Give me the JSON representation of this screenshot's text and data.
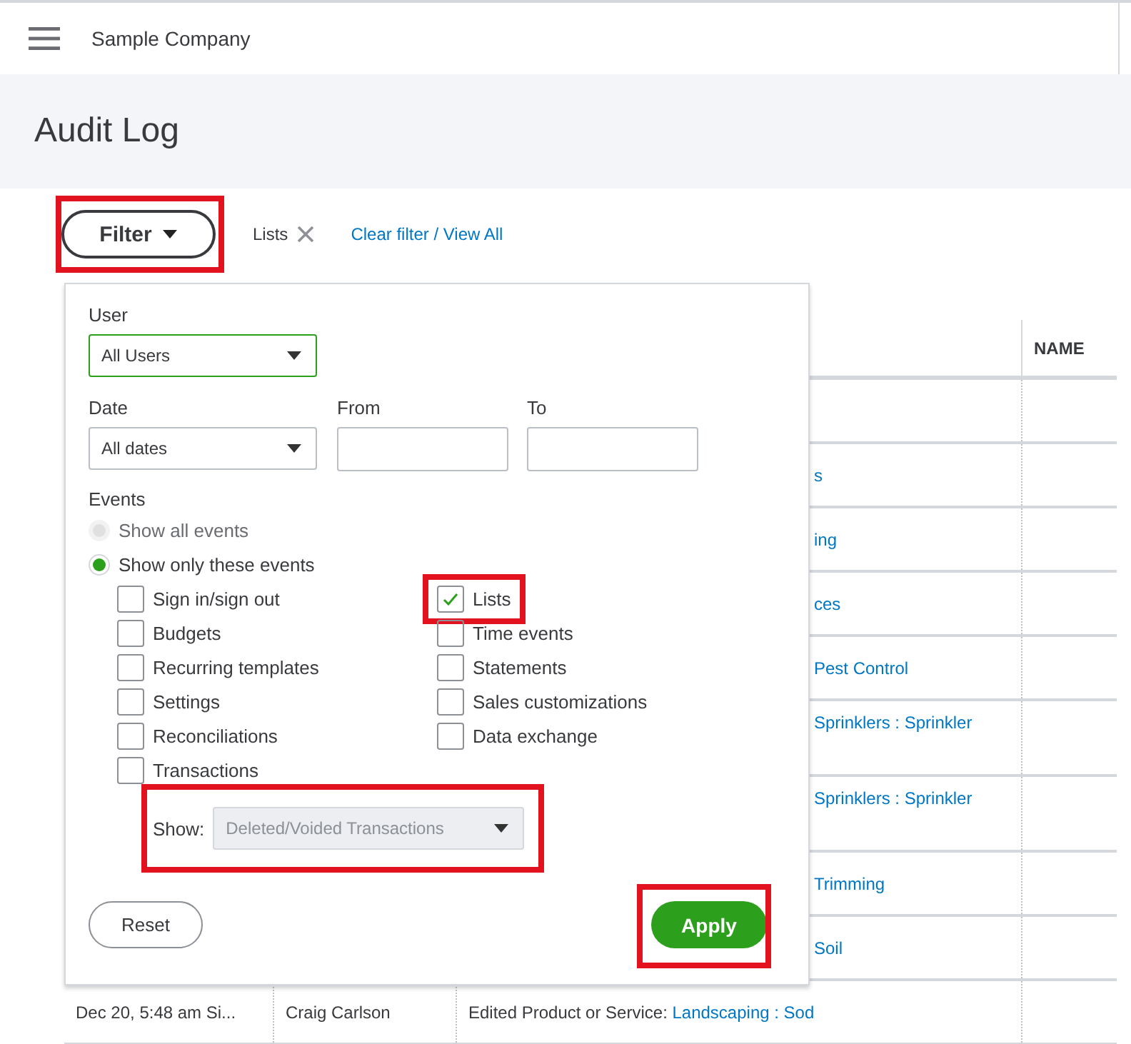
{
  "top_bar": {
    "company": "Sample Company"
  },
  "page_title": "Audit Log",
  "filter_bar": {
    "filter_button": {
      "label": "Filter",
      "highlighted": true
    },
    "chip": {
      "label": "Lists"
    },
    "clear_link": "Clear filter / View All"
  },
  "table": {
    "header": "NAME",
    "rows": [
      {
        "kind": "covered",
        "tall": false
      },
      {
        "kind": "covered",
        "tall": false,
        "event_link": "s"
      },
      {
        "kind": "covered",
        "tall": false,
        "event_link": "ing"
      },
      {
        "kind": "covered",
        "tall": false,
        "event_link": "ces"
      },
      {
        "kind": "covered",
        "tall": false,
        "event_link": "Pest Control"
      },
      {
        "kind": "covered",
        "tall": true,
        "event_link": "Sprinklers : Sprinkler"
      },
      {
        "kind": "covered",
        "tall": true,
        "event_link": "Sprinklers : Sprinkler"
      },
      {
        "kind": "covered",
        "tall": false,
        "event_link": "Trimming"
      },
      {
        "kind": "covered",
        "tall": false,
        "event_link": "Soil"
      },
      {
        "kind": "full",
        "tall": false,
        "date": "Dec 20, 5:48 am Si...",
        "user": "Craig Carlson",
        "event_text": "Edited Product or Service:",
        "event_link": "Landscaping : Sod"
      }
    ]
  },
  "filter_panel": {
    "user": {
      "label": "User",
      "value": "All Users",
      "focused": true
    },
    "date": {
      "label": "Date",
      "value": "All dates",
      "focused": false
    },
    "from": {
      "label": "From"
    },
    "to": {
      "label": "To"
    },
    "events_label": "Events",
    "radios": [
      {
        "label": "Show all events",
        "selected": false,
        "disabled": true
      },
      {
        "label": "Show only these events",
        "selected": true,
        "disabled": false
      }
    ],
    "checkbox_columns": [
      [
        {
          "label": "Sign in/sign out",
          "checked": false,
          "highlighted": false
        },
        {
          "label": "Budgets",
          "checked": false,
          "highlighted": false
        },
        {
          "label": "Recurring templates",
          "checked": false,
          "highlighted": false
        },
        {
          "label": "Settings",
          "checked": false,
          "highlighted": false
        },
        {
          "label": "Reconciliations",
          "checked": false,
          "highlighted": false
        },
        {
          "label": "Transactions",
          "checked": false,
          "highlighted": false
        }
      ],
      [
        {
          "label": "Lists",
          "checked": true,
          "highlighted": true
        },
        {
          "label": "Time events",
          "checked": false,
          "highlighted": false
        },
        {
          "label": "Statements",
          "checked": false,
          "highlighted": false
        },
        {
          "label": "Sales customizations",
          "checked": false,
          "highlighted": false
        },
        {
          "label": "Data exchange",
          "checked": false,
          "highlighted": false
        }
      ]
    ],
    "show": {
      "label": "Show:",
      "value": "Deleted/Voided Transactions",
      "disabled": true,
      "highlighted": true
    },
    "reset_button": {
      "label": "Reset"
    },
    "apply_button": {
      "label": "Apply",
      "highlighted": true
    }
  }
}
